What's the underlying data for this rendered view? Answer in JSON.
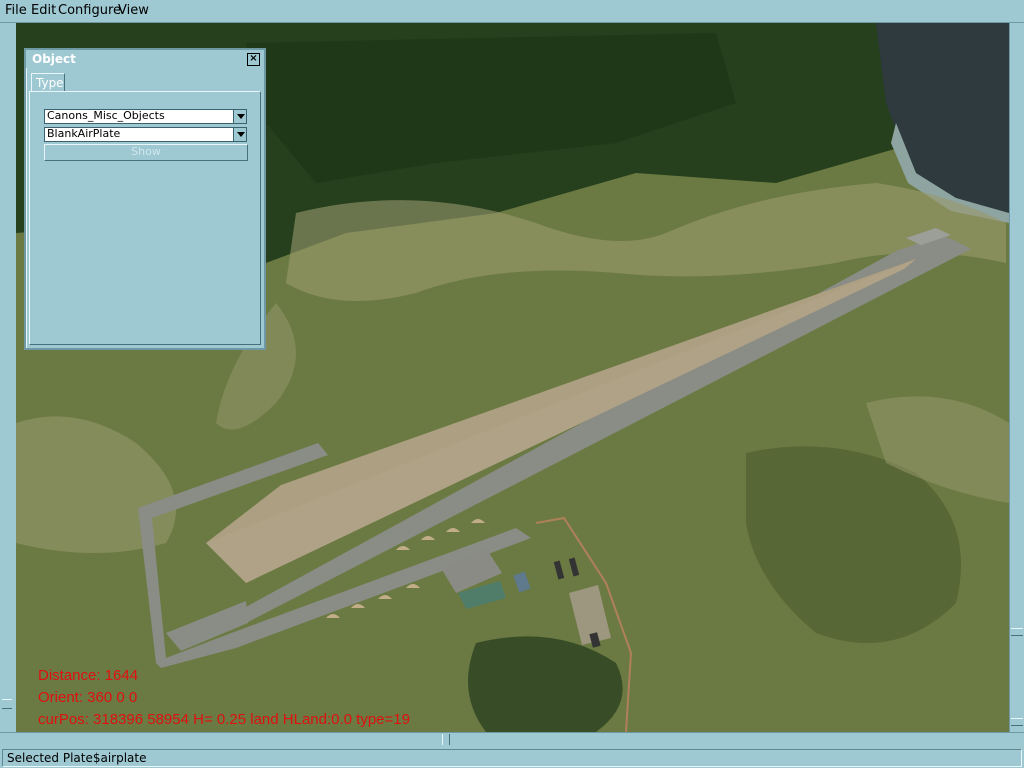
{
  "menu": {
    "file": "File",
    "edit": "Edit",
    "configure": "Configure",
    "view": "View"
  },
  "object_panel": {
    "title": "Object",
    "close_glyph": "×",
    "tab_label": "Type",
    "category_value": "Canons_Misc_Objects",
    "object_value": "BlankAirPlate",
    "show_button_label": "Show"
  },
  "overlay": {
    "distance": "Distance: 1644",
    "orient": "Orient: 360 0 0",
    "curpos": "curPos: 318396 58954 H= 0.25 land HLand:0.0 type=19"
  },
  "status": {
    "text": "Selected Plate$airplate"
  },
  "colors": {
    "chrome": "#9ec8d2",
    "overlay_text": "#e01010"
  }
}
